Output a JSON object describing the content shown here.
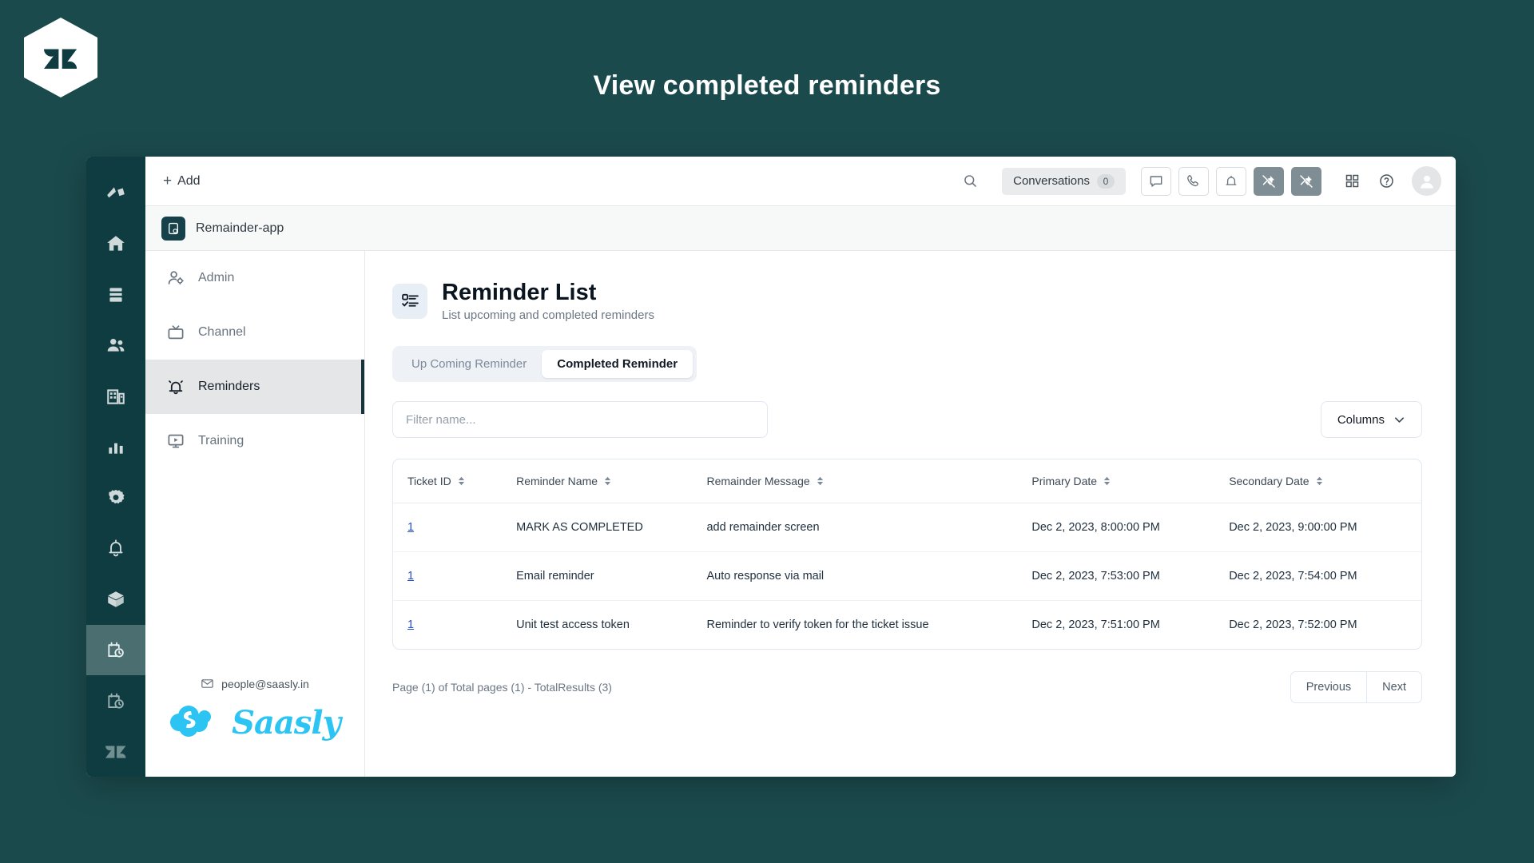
{
  "banner": {
    "title": "View completed reminders",
    "logo_icon": "zendesk-hex-logo",
    "background_color": "#1b4a4d"
  },
  "rail": {
    "items": [
      {
        "icon": "zendesk-product-logo-icon",
        "active": false
      },
      {
        "icon": "home-icon",
        "active": false
      },
      {
        "icon": "views-icon",
        "active": false
      },
      {
        "icon": "customers-icon",
        "active": false
      },
      {
        "icon": "organizations-icon",
        "active": false
      },
      {
        "icon": "reporting-icon",
        "active": false
      },
      {
        "icon": "settings-gear-icon",
        "active": false
      },
      {
        "icon": "bell-icon",
        "active": false
      },
      {
        "icon": "apps-box-icon",
        "active": false
      },
      {
        "icon": "calendar-clock-icon",
        "active": true
      },
      {
        "icon": "calendar-clock-icon",
        "active": false
      },
      {
        "icon": "zendesk-z-icon",
        "active": false
      }
    ]
  },
  "topbar": {
    "add_label": "Add",
    "add_icon": "plus-icon",
    "search_icon": "search-icon",
    "conversations_label": "Conversations",
    "conversations_count": "0",
    "buttons": [
      {
        "icon": "chat-bubble-icon",
        "filled": false
      },
      {
        "icon": "phone-icon",
        "filled": false
      },
      {
        "icon": "bell-icon",
        "filled": false
      },
      {
        "icon": "pin-off-icon",
        "filled": true
      },
      {
        "icon": "pin-off-icon",
        "filled": true
      }
    ],
    "grid_icon": "grid-apps-icon",
    "help_icon": "help-circle-icon",
    "avatar_icon": "user-avatar-icon"
  },
  "app_strip": {
    "title": "Remainder-app",
    "icon": "reminder-app-icon"
  },
  "navpanel": {
    "items": [
      {
        "label": "Admin",
        "icon": "admin-user-gear-icon",
        "active": false
      },
      {
        "label": "Channel",
        "icon": "channel-tv-icon",
        "active": false
      },
      {
        "label": "Reminders",
        "icon": "reminder-bell-icon",
        "active": true
      },
      {
        "label": "Training",
        "icon": "training-monitor-play-icon",
        "active": false
      }
    ],
    "footer": {
      "email": "people@saasly.in",
      "mail_icon": "envelope-icon",
      "brand": "Saasly",
      "brand_icon": "saasly-cloud-icon",
      "brand_color": "#2bc4f3"
    }
  },
  "main": {
    "page_icon": "checklist-icon",
    "title": "Reminder List",
    "subtitle": "List upcoming and completed reminders",
    "tabs": [
      {
        "label": "Up Coming Reminder",
        "active": false
      },
      {
        "label": "Completed Reminder",
        "active": true
      }
    ],
    "filter": {
      "value": "",
      "placeholder": "Filter name..."
    },
    "columns_button": {
      "label": "Columns",
      "icon": "chevron-down-icon"
    },
    "table": {
      "headers": [
        "Ticket ID",
        "Reminder Name",
        "Remainder Message",
        "Primary Date",
        "Secondary Date"
      ],
      "rows": [
        {
          "ticket_id": "1",
          "reminder_name": "MARK AS COMPLETED",
          "remainder_message": "add remainder screen",
          "primary_date": "Dec 2, 2023, 8:00:00 PM",
          "secondary_date": "Dec 2, 2023, 9:00:00 PM"
        },
        {
          "ticket_id": "1",
          "reminder_name": "Email reminder",
          "remainder_message": "Auto response via mail",
          "primary_date": "Dec 2, 2023, 7:53:00 PM",
          "secondary_date": "Dec 2, 2023, 7:54:00 PM"
        },
        {
          "ticket_id": "1",
          "reminder_name": "Unit test access token",
          "remainder_message": "Reminder to verify token for the ticket issue",
          "primary_date": "Dec 2, 2023, 7:51:00 PM",
          "secondary_date": "Dec 2, 2023, 7:52:00 PM"
        }
      ]
    },
    "pagination": {
      "summary": "Page (1) of Total pages (1) - TotalResults (3)",
      "previous_label": "Previous",
      "next_label": "Next"
    }
  }
}
